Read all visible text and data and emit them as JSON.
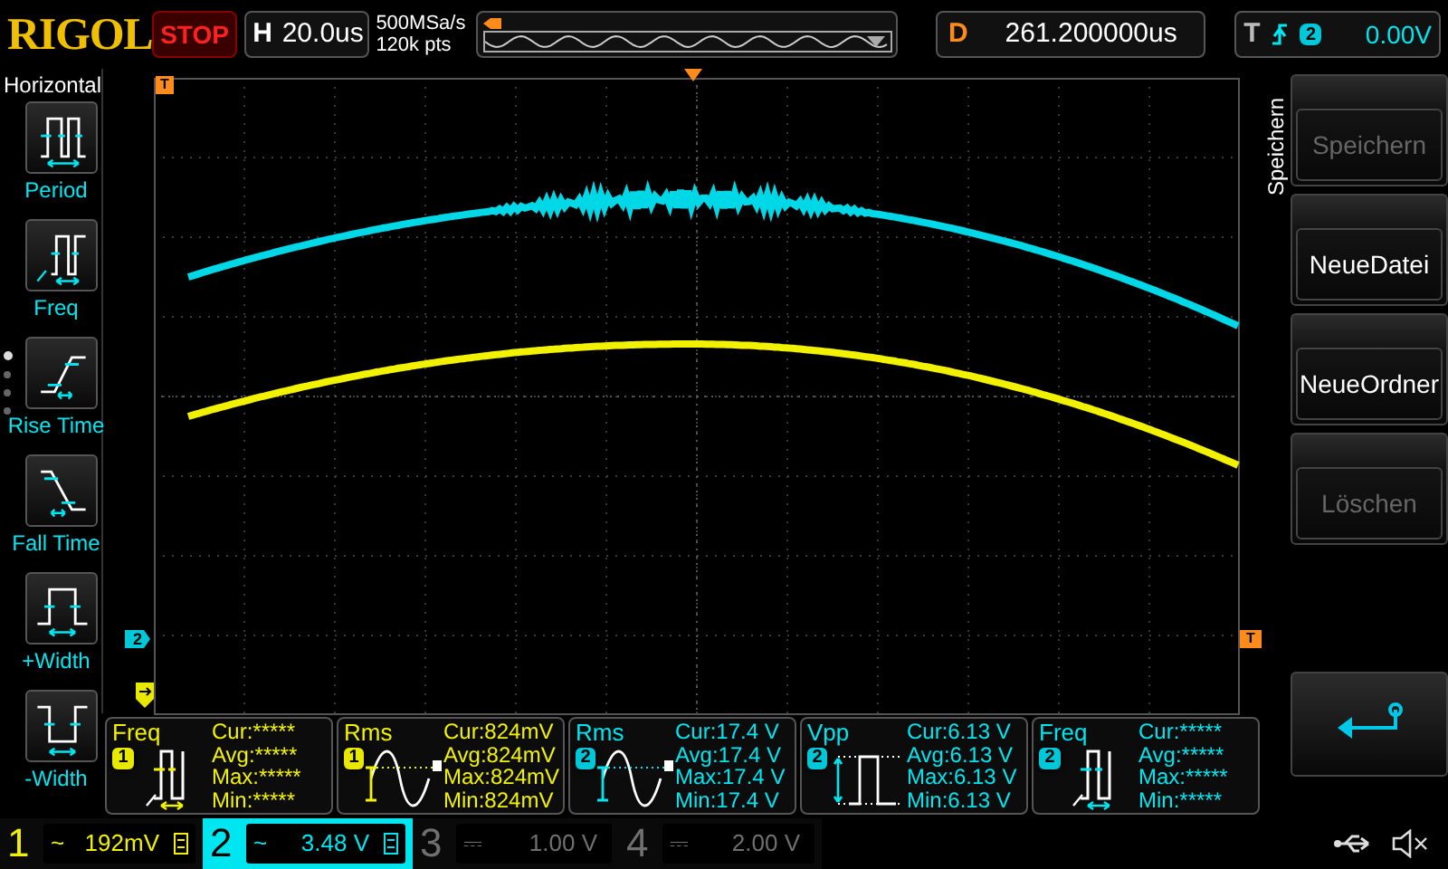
{
  "brand": "RIGOL",
  "run_state": "STOP",
  "timebase": {
    "label": "H",
    "value": "20.0us"
  },
  "sample": {
    "rate": "500MSa/s",
    "points": "120k pts"
  },
  "delay": {
    "label": "D",
    "value": "261.200000us"
  },
  "trigger": {
    "label": "T",
    "source": "2",
    "level": "0.00V"
  },
  "left_menu": {
    "title": "Horizontal",
    "pages": [
      {
        "selected": true
      },
      {
        "selected": false
      },
      {
        "selected": false
      },
      {
        "selected": false
      }
    ],
    "items": [
      {
        "label": "Period",
        "kind": "period"
      },
      {
        "label": "Freq",
        "kind": "freq"
      },
      {
        "label": "Rise Time",
        "kind": "rise"
      },
      {
        "label": "Fall Time",
        "kind": "fall"
      },
      {
        "label": "+Width",
        "kind": "pwidth"
      },
      {
        "label": "-Width",
        "kind": "nwidth"
      }
    ]
  },
  "plot": {
    "trigger_marker_top": "T",
    "channel_marker": "2",
    "trigger_marker_right": "T"
  },
  "right_menu": {
    "title": "Speichern",
    "items": [
      {
        "kind": "text",
        "label": "Speichern",
        "disabled": true
      },
      {
        "kind": "text",
        "label": "NeueDatei",
        "disabled": false
      },
      {
        "kind": "text",
        "label": "NeueOrdner",
        "disabled": false
      },
      {
        "kind": "text",
        "label": "Löschen",
        "disabled": true
      },
      {
        "kind": "back"
      }
    ]
  },
  "measurements": [
    {
      "name": "Freq",
      "channel": "1",
      "kind": "freq",
      "rows": [
        "Cur:*****",
        "Avg:*****",
        "Max:*****",
        "Min:*****"
      ]
    },
    {
      "name": "Rms",
      "channel": "1",
      "kind": "rms",
      "rows": [
        "Cur:824mV",
        "Avg:824mV",
        "Max:824mV",
        "Min:824mV"
      ]
    },
    {
      "name": "Rms",
      "channel": "2",
      "kind": "rms",
      "rows": [
        "Cur:17.4 V",
        "Avg:17.4 V",
        "Max:17.4 V",
        "Min:17.4 V"
      ]
    },
    {
      "name": "Vpp",
      "channel": "2",
      "kind": "vpp",
      "rows": [
        "Cur:6.13 V",
        "Avg:6.13 V",
        "Max:6.13 V",
        "Min:6.13 V"
      ]
    },
    {
      "name": "Freq",
      "channel": "2",
      "kind": "freq",
      "rows": [
        "Cur:*****",
        "Avg:*****",
        "Max:*****",
        "Min:*****"
      ]
    }
  ],
  "channels": [
    {
      "number": "1",
      "coupling": "~",
      "scale": "192mV",
      "enabled": true,
      "selected": false,
      "bw_limit": true
    },
    {
      "number": "2",
      "coupling": "~",
      "scale": "3.48 V",
      "enabled": true,
      "selected": true,
      "bw_limit": true
    },
    {
      "number": "3",
      "coupling": "⎓",
      "scale": "1.00 V",
      "enabled": false,
      "selected": false,
      "bw_limit": false
    },
    {
      "number": "4",
      "coupling": "⎓",
      "scale": "2.00 V",
      "enabled": false,
      "selected": false,
      "bw_limit": false
    }
  ]
}
